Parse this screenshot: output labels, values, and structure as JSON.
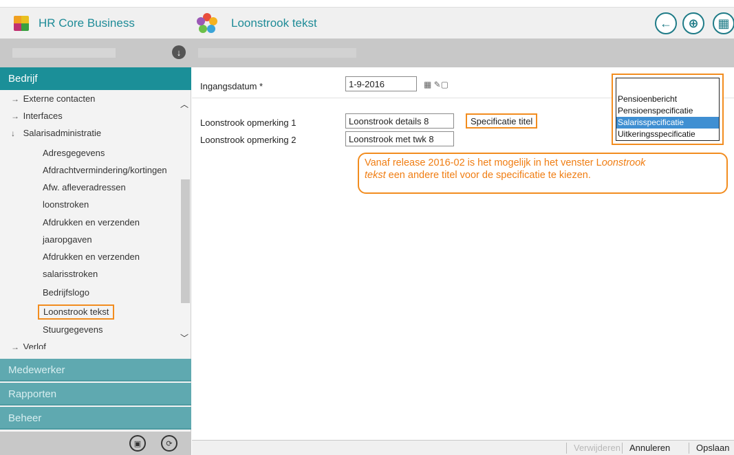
{
  "header": {
    "app_title": "HR Core Business",
    "page_title": "Loonstrook tekst",
    "buttons": [
      {
        "icon": "back-arrow-icon",
        "glyph": "←"
      },
      {
        "icon": "search-zoom-icon",
        "glyph": "⊕"
      },
      {
        "icon": "calendar-icon",
        "glyph": "▦"
      }
    ]
  },
  "sidebar": {
    "active_section": "Bedrijf",
    "tree": [
      {
        "label": "Externe contacten",
        "level": 1,
        "arrow": "→"
      },
      {
        "label": "Interfaces",
        "level": 1,
        "arrow": "→"
      },
      {
        "label": "Salarisadministratie",
        "level": 1,
        "arrow": "↓"
      },
      {
        "label": "Adresgegevens",
        "level": 2
      },
      {
        "label": "Afdrachtvermindering/kortingen",
        "level": 2
      },
      {
        "label": "Afw. afleveradressen",
        "level": 2
      },
      {
        "label": "loonstroken",
        "level": 2
      },
      {
        "label": "Afdrukken en verzenden",
        "level": 2
      },
      {
        "label": "jaaropgaven",
        "level": 2
      },
      {
        "label": "Afdrukken en verzenden",
        "level": 2
      },
      {
        "label": "salarisstroken",
        "level": 2
      },
      {
        "label": "Bedrijfslogo",
        "level": 2
      },
      {
        "label": "Loonstrook tekst",
        "level": 2,
        "selected": true
      },
      {
        "label": "Stuurgegevens",
        "level": 2
      },
      {
        "label": "Verlof",
        "level": 1,
        "arrow": "→"
      }
    ],
    "sections_closed": [
      "Medewerker",
      "Rapporten",
      "Beheer"
    ]
  },
  "form": {
    "date_label": "Ingangsdatum *",
    "date_value": "1-9-2016",
    "row1_label": "Loonstrook opmerking 1",
    "row1_value": "Loonstrook details 8",
    "row2_label": "Loonstrook opmerking 2",
    "row2_value": "Loonstrook met twk 8",
    "spec_button": "Specificatie titel",
    "dropdown_options": [
      "Pensioenbericht",
      "Pensioenspecificatie",
      "Salarisspecificatie",
      "Uitkeringsspecificatie"
    ],
    "dropdown_selected": "Salarisspecificatie"
  },
  "callout": {
    "line1_pre": "Vanaf release 2016-02 is het mogelijk in het venster L",
    "line1_italic": "oonstrook",
    "line2_italic": "tekst",
    "line2_post": " een andere titel voor de specificatie te kiezen."
  },
  "footer": {
    "delete": "Verwijderen",
    "cancel": "Annuleren",
    "save": "Opslaan"
  },
  "colors": {
    "accent": "#1b8f98",
    "highlight_orange": "#f28c1e",
    "selected_option": "#3f8fd2"
  }
}
